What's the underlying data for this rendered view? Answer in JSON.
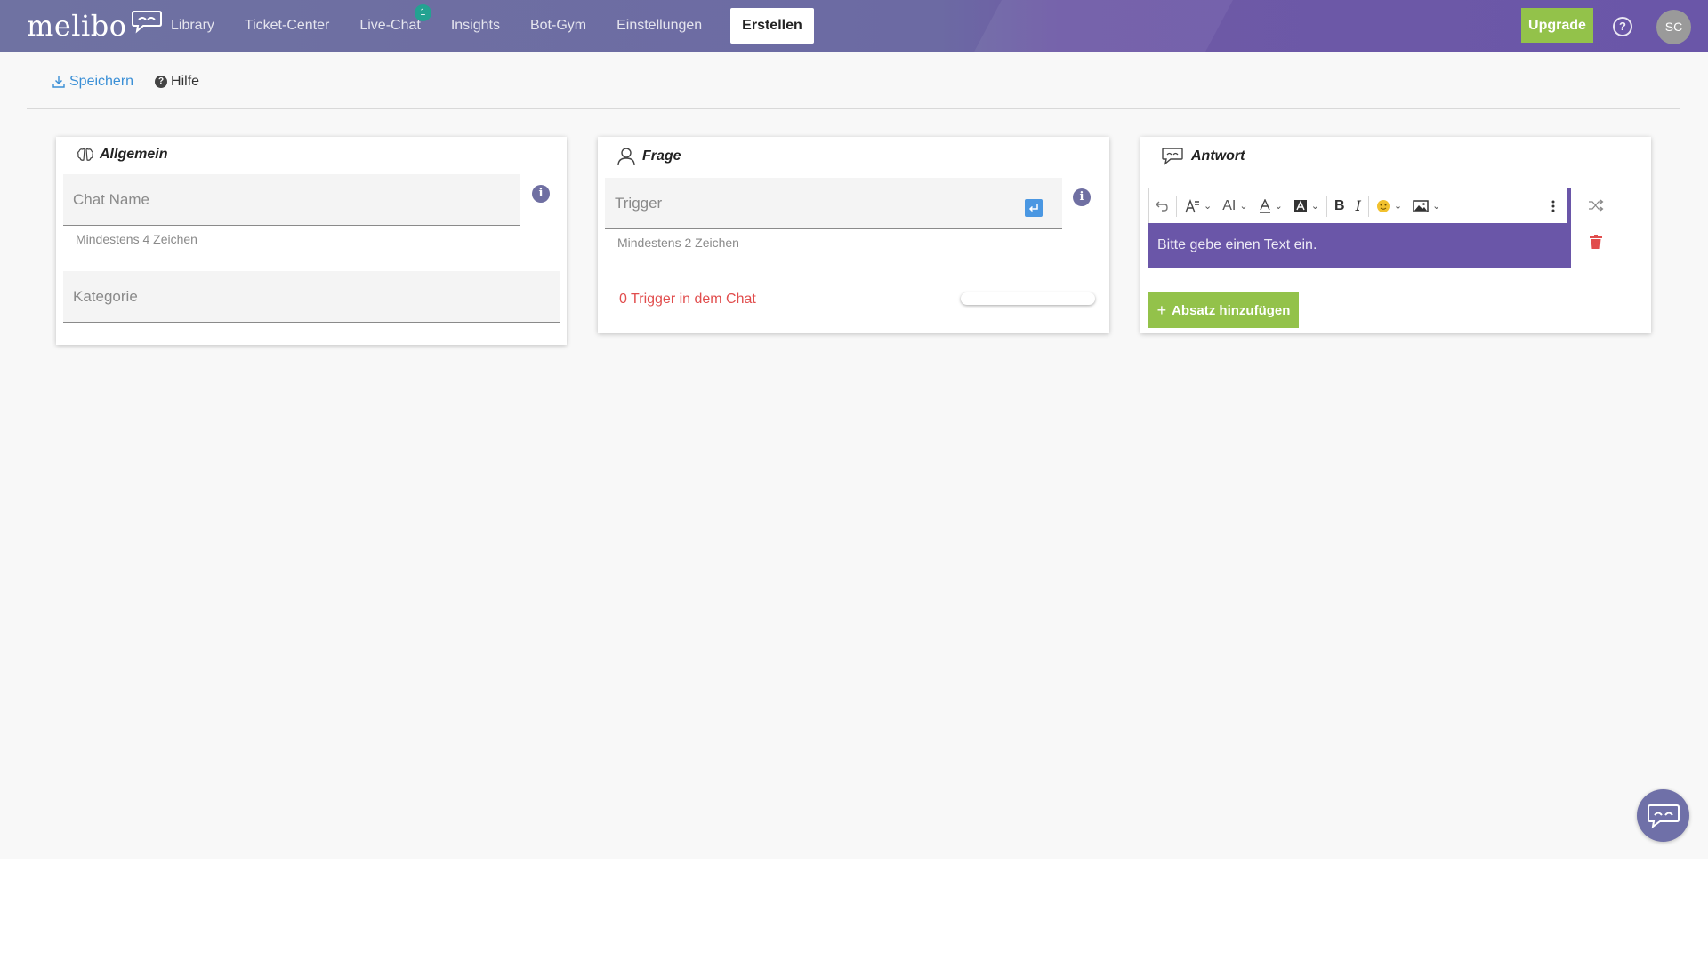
{
  "header": {
    "logo": "melibo",
    "nav": [
      {
        "label": "Library"
      },
      {
        "label": "Ticket-Center"
      },
      {
        "label": "Live-Chat",
        "badge": "1"
      },
      {
        "label": "Insights"
      },
      {
        "label": "Bot-Gym"
      },
      {
        "label": "Einstellungen"
      },
      {
        "label": "Erstellen",
        "active": true
      }
    ],
    "upgrade_label": "Upgrade",
    "help_icon": "question-circle-icon",
    "avatar_initials": "SC"
  },
  "actions": {
    "save_label": "Speichern",
    "help_label": "Hilfe"
  },
  "cards": {
    "allgemein": {
      "title": "Allgemein",
      "chat_name_placeholder": "Chat Name",
      "chat_name_hint": "Mindestens 4 Zeichen",
      "kategorie_placeholder": "Kategorie"
    },
    "frage": {
      "title": "Frage",
      "trigger_placeholder": "Trigger",
      "trigger_hint": "Mindestens 2 Zeichen",
      "trigger_count": "0 Trigger in dem Chat"
    },
    "antwort": {
      "title": "Antwort",
      "toolbar_size": "AI",
      "editor_placeholder": "Bitte gebe einen Text ein.",
      "add_paragraph_label": "Absatz hinzufügen"
    }
  },
  "colors": {
    "brand_purple": "#6a56a8",
    "accent_green": "#93c24a",
    "link_blue": "#3a8fd6",
    "error_red": "#e14d4d",
    "badge_teal": "#23a291"
  }
}
